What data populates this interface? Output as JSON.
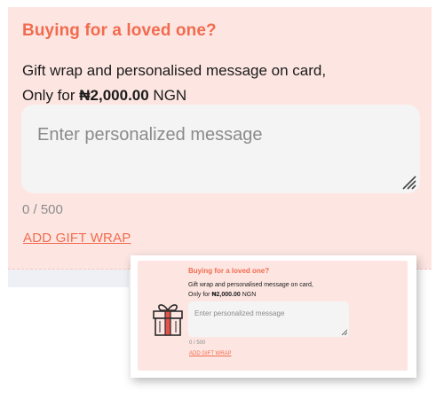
{
  "main": {
    "title": "Buying for a loved one?",
    "desc_line1": "Gift wrap and personalised message on card,",
    "desc_prefix": "Only for ",
    "price": "₦2,000.00",
    "currency": " NGN",
    "placeholder": "Enter personalized message",
    "counter": "0 / 500",
    "add_link": "ADD GIFT WRAP"
  },
  "popup": {
    "title": "Buying for a loved one?",
    "desc_line1": "Gift wrap and personalised message on card,",
    "desc_prefix": "Only for ",
    "price": "₦2,000.00",
    "currency": " NGN",
    "placeholder": "Enter personalized message",
    "counter": "0 / 500",
    "add_link": "ADD GIFT WRAP",
    "icon": "gift-box-icon"
  },
  "colors": {
    "accent": "#f26b4e",
    "panel_bg": "#fde6e2",
    "input_bg": "#f5f4f4",
    "muted_text": "#8b8b8b"
  }
}
